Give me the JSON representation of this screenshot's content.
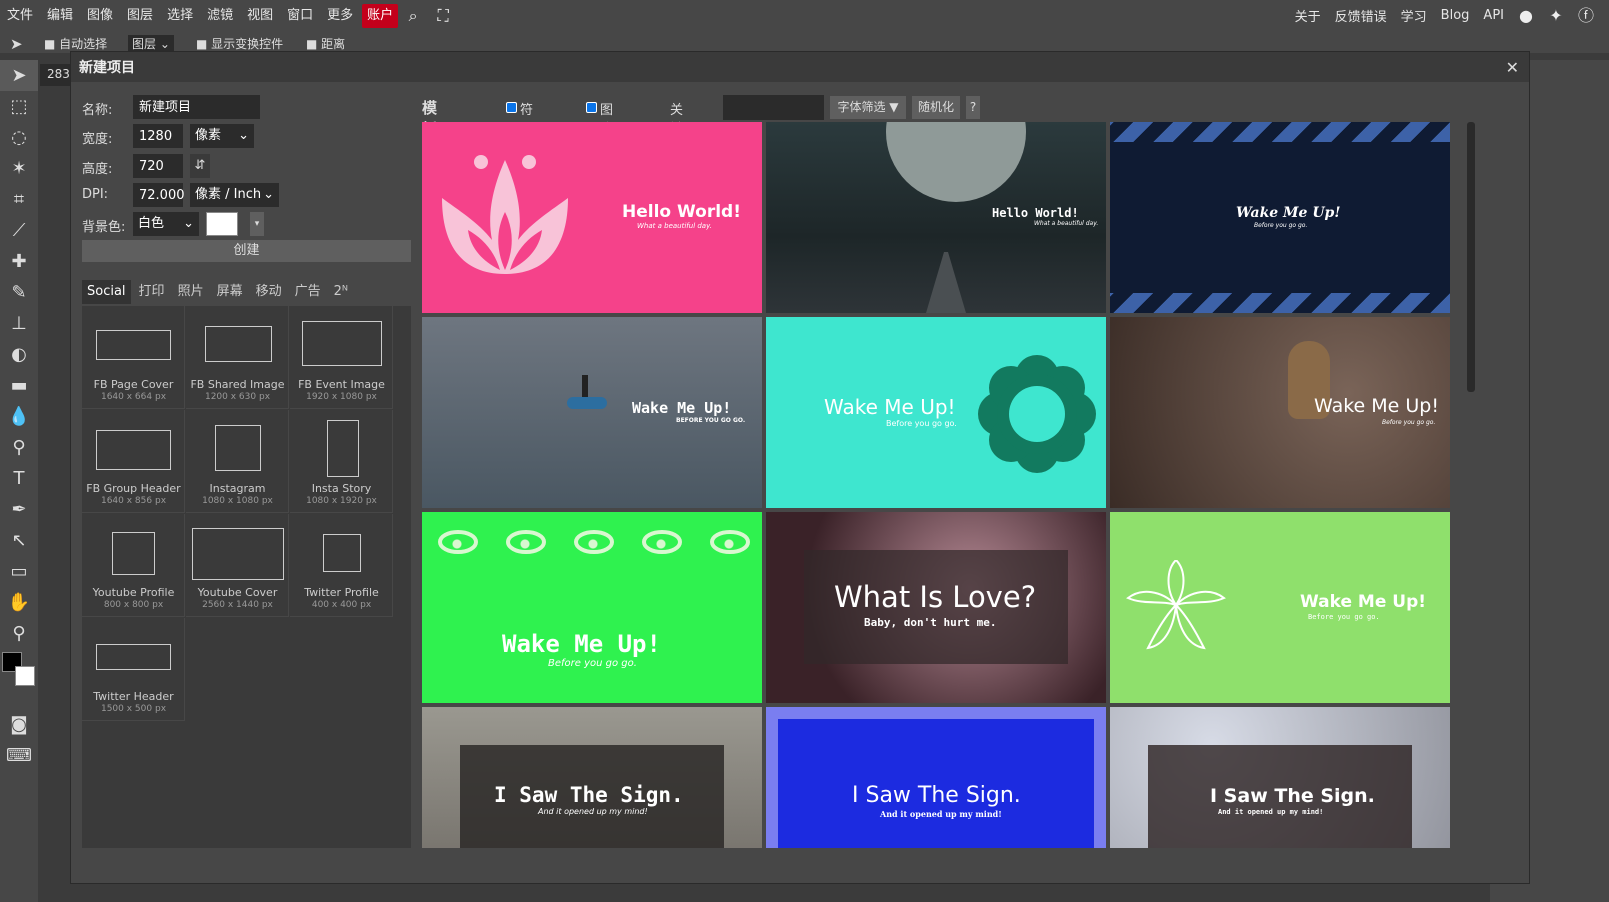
{
  "menu": {
    "items": [
      "文件",
      "编辑",
      "图像",
      "图层",
      "选择",
      "滤镜",
      "视图",
      "窗口",
      "更多"
    ],
    "account": "账户",
    "right": [
      "关于",
      "反馈错误",
      "学习",
      "Blog",
      "API"
    ]
  },
  "options": {
    "auto_select": "自动选择",
    "layer_select": "图层",
    "show_transform": "显示变换控件",
    "distance": "距离"
  },
  "canvas_tab": "283",
  "modal": {
    "title": "新建项目",
    "name_label": "名称:",
    "name_value": "新建项目",
    "width_label": "宽度:",
    "width_value": "1280",
    "unit": "像素",
    "height_label": "高度:",
    "height_value": "720",
    "swap_icon": "⇵",
    "dpi_label": "DPI:",
    "dpi_value": "72.000",
    "dpi_unit": "像素 / Inch",
    "bg_label": "背景色:",
    "bg_value": "白色",
    "create": "创建",
    "tabs": [
      "Social",
      "打印",
      "照片",
      "屏幕",
      "移动",
      "广告",
      "2ᴺ"
    ],
    "presets": [
      {
        "name": "FB Page Cover",
        "size": "1640 x 664 px"
      },
      {
        "name": "FB Shared Image",
        "size": "1200 x 630 px"
      },
      {
        "name": "FB Event Image",
        "size": "1920 x 1080 px"
      },
      {
        "name": "FB Group Header",
        "size": "1640 x 856 px"
      },
      {
        "name": "Instagram",
        "size": "1080 x 1080 px"
      },
      {
        "name": "Insta Story",
        "size": "1080 x 1920 px"
      },
      {
        "name": "Youtube Profile",
        "size": "800 x 800 px"
      },
      {
        "name": "Youtube Cover",
        "size": "2560 x 1440 px"
      },
      {
        "name": "Twitter Profile",
        "size": "400 x 400 px"
      },
      {
        "name": "Twitter Header",
        "size": "1500 x 500 px"
      }
    ],
    "templates_label": "模板",
    "symbols_label": "符号",
    "images_label": "图片",
    "keyword_label": "关键词:",
    "font_filter": "字体筛选 ▼",
    "randomize": "随机化",
    "help": "?",
    "templates": [
      {
        "title": "Hello World!",
        "sub": "What a beautiful day.",
        "bg": "#f5428a"
      },
      {
        "title": "Hello World!",
        "sub": "What a beautiful day.",
        "bg": "#1f2a2c"
      },
      {
        "title": "Wake Me Up!",
        "sub": "Before you go go.",
        "bg": "#0f1b33"
      },
      {
        "title": "Wake Me Up!",
        "sub": "BEFORE YOU GO GO.",
        "bg": "#5a6570"
      },
      {
        "title": "Wake Me Up!",
        "sub": "Before you go go.",
        "bg": "#3ee6cf"
      },
      {
        "title": "Wake Me Up!",
        "sub": "Before you go go.",
        "bg": "#5b4a42"
      },
      {
        "title": "Wake Me Up!",
        "sub": "Before you go go.",
        "bg": "#2ff24f"
      },
      {
        "title": "What Is Love?",
        "sub": "Baby, don't hurt me.",
        "bg": "#2a1e22"
      },
      {
        "title": "Wake Me Up!",
        "sub": "Before you go go.",
        "bg": "#8fe06c"
      },
      {
        "title": "I Saw The Sign.",
        "sub": "And it opened up my mind!",
        "bg": "#8a8a86"
      },
      {
        "title": "I Saw The Sign.",
        "sub": "And it opened up my mind!",
        "bg": "#1c2be0"
      },
      {
        "title": "I Saw The Sign.",
        "sub": "And it opened up my mind!",
        "bg": "#a7a9b3"
      }
    ]
  }
}
